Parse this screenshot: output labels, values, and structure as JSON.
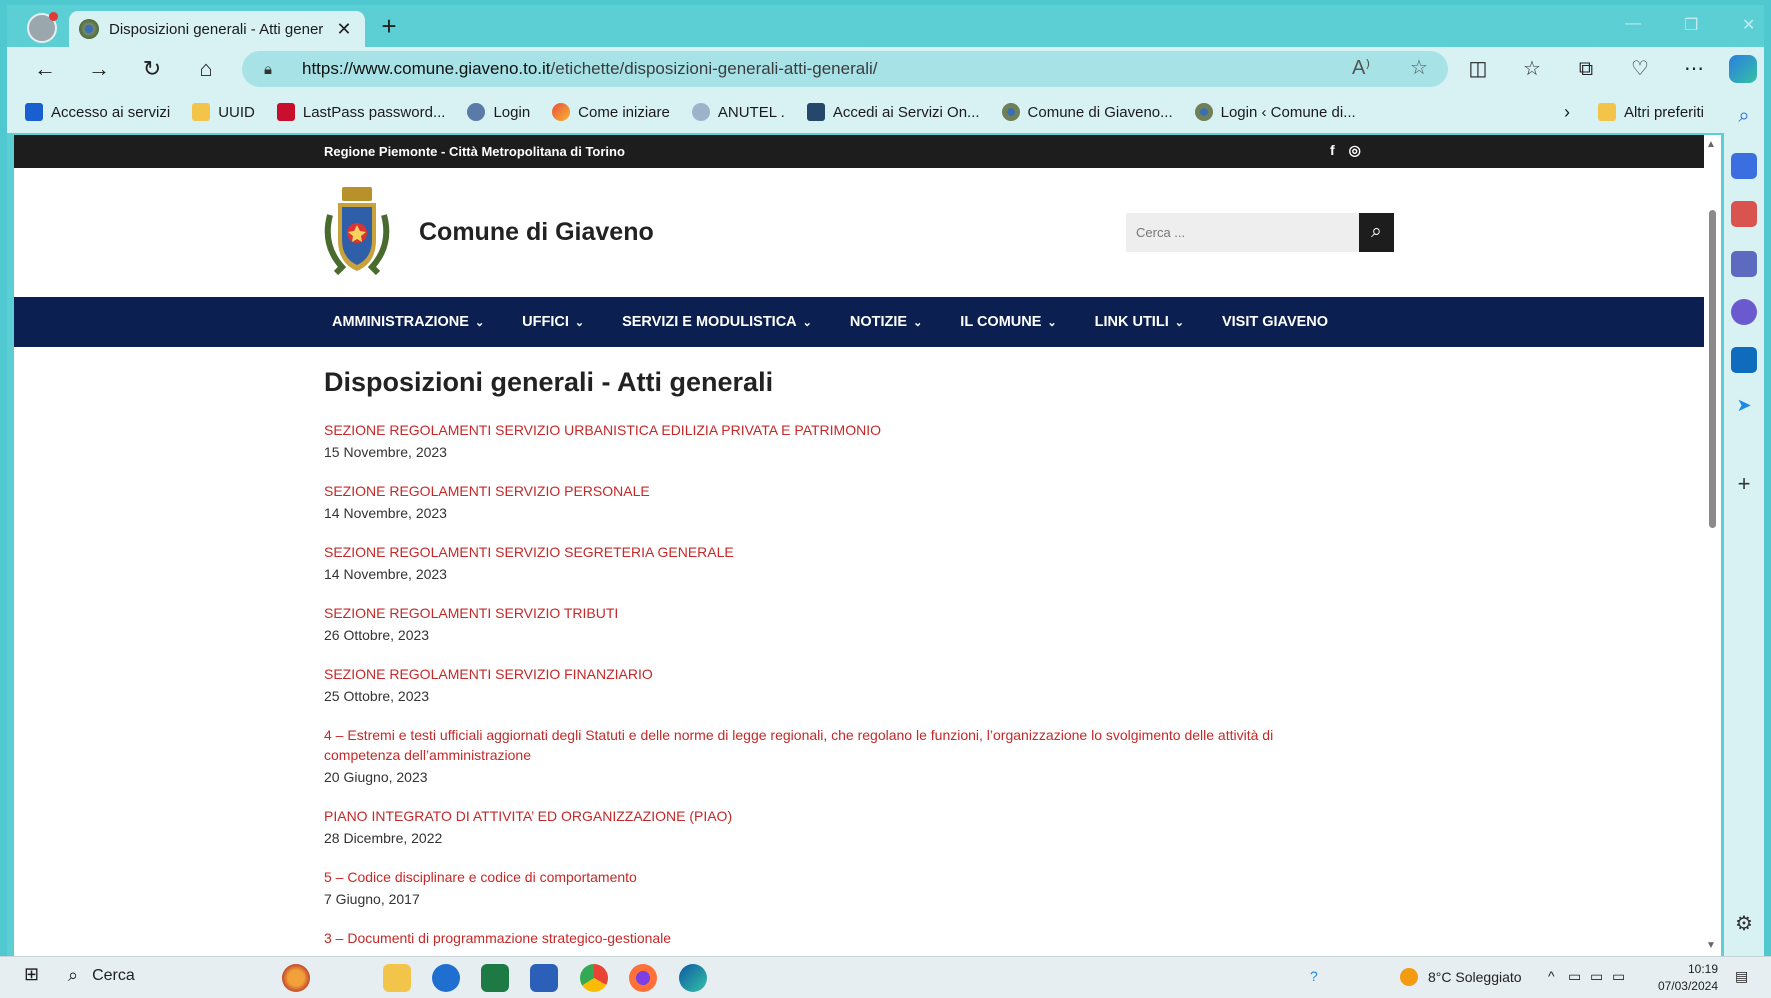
{
  "browser": {
    "tab_title": "Disposizioni generali - Atti gener",
    "url_domain": "https://www.comune.giaveno.to.it",
    "url_path": "/etichette/disposizioni-generali-atti-generali/",
    "bookmarks": [
      {
        "label": "Accesso ai servizi",
        "icon": "tracker-icon"
      },
      {
        "label": "UUID",
        "icon": "folder-icon"
      },
      {
        "label": "LastPass password...",
        "icon": "lastpass-icon"
      },
      {
        "label": "Login",
        "icon": "login-icon"
      },
      {
        "label": "Come iniziare",
        "icon": "edge-icon"
      },
      {
        "label": "ANUTEL .",
        "icon": "anutel-icon"
      },
      {
        "label": "Accedi ai Servizi On...",
        "icon": "services-icon"
      },
      {
        "label": "Comune di Giaveno...",
        "icon": "crest-icon"
      },
      {
        "label": "Login ‹ Comune di...",
        "icon": "crest-icon"
      }
    ],
    "other_favorites": "Altri preferiti"
  },
  "site": {
    "region_line": "Regione Piemonte - Città Metropolitana di Torino",
    "name": "Comune di Giaveno",
    "search_placeholder": "Cerca ...",
    "nav": [
      {
        "label": "AMMINISTRAZIONE",
        "dropdown": true
      },
      {
        "label": "UFFICI",
        "dropdown": true
      },
      {
        "label": "SERVIZI E MODULISTICA",
        "dropdown": true
      },
      {
        "label": "NOTIZIE",
        "dropdown": true
      },
      {
        "label": "IL COMUNE",
        "dropdown": true
      },
      {
        "label": "LINK UTILI",
        "dropdown": true
      },
      {
        "label": "VISIT GIAVENO",
        "dropdown": false
      }
    ]
  },
  "main": {
    "page_title": "Disposizioni generali - Atti generali",
    "entries": [
      {
        "title": "SEZIONE REGOLAMENTI SERVIZIO URBANISTICA EDILIZIA PRIVATA E PATRIMONIO",
        "date": "15 Novembre, 2023"
      },
      {
        "title": "SEZIONE REGOLAMENTI SERVIZIO PERSONALE",
        "date": "14 Novembre, 2023"
      },
      {
        "title": "SEZIONE REGOLAMENTI SERVIZIO SEGRETERIA GENERALE",
        "date": "14 Novembre, 2023"
      },
      {
        "title": "SEZIONE REGOLAMENTI SERVIZIO TRIBUTI",
        "date": "26 Ottobre, 2023"
      },
      {
        "title": "SEZIONE REGOLAMENTI SERVIZIO FINANZIARIO",
        "date": "25 Ottobre, 2023"
      },
      {
        "title": "4 – Estremi e testi ufficiali aggiornati degli Statuti e delle norme di legge regionali, che regolano le funzioni, l’organizzazione lo svolgimento delle attività di competenza dell’amministrazione",
        "date": "20 Giugno, 2023"
      },
      {
        "title": "PIANO INTEGRATO DI ATTIVITA’ ED ORGANIZZAZIONE (PIAO)",
        "date": "28 Dicembre, 2022"
      },
      {
        "title": "5 – Codice disciplinare e codice di comportamento",
        "date": "7 Giugno, 2017"
      },
      {
        "title": "3 – Documenti di programmazione strategico-gestionale",
        "date": ""
      }
    ]
  },
  "taskbar": {
    "search_label": "Cerca",
    "weather": "8°C  Soleggiato",
    "time": "10:19",
    "date": "07/03/2024"
  },
  "colors": {
    "link_red": "#c62828",
    "nav_blue": "#0b2050",
    "browser_teal": "#5bcfd4"
  }
}
